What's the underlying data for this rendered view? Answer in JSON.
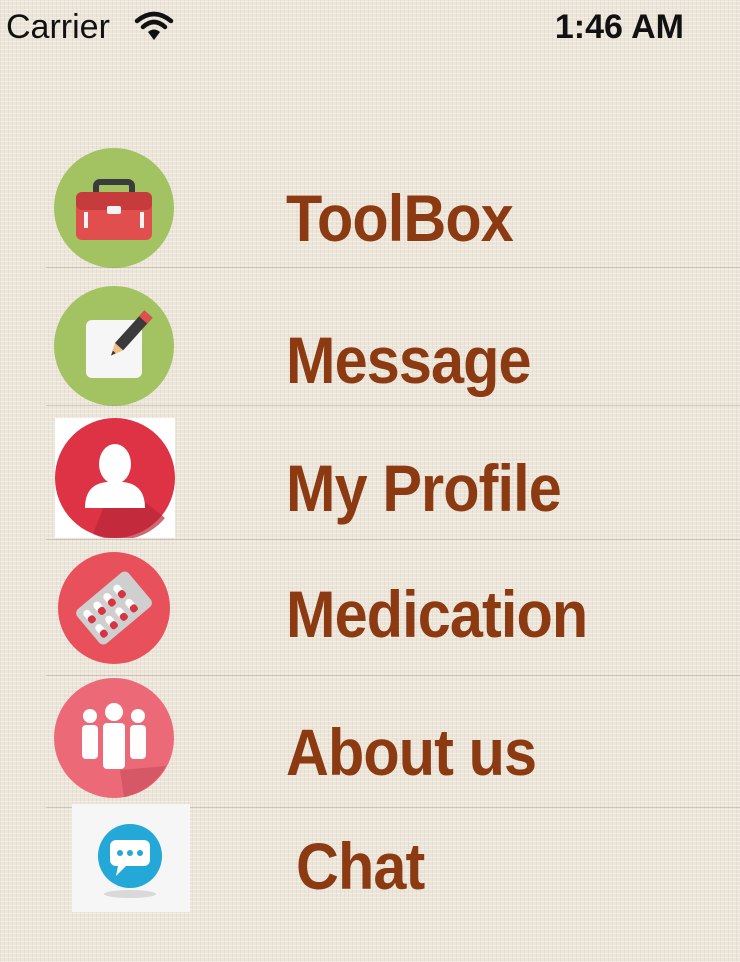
{
  "status_bar": {
    "carrier": "Carrier",
    "time": "1:46 AM",
    "wifi_icon": "wifi-icon"
  },
  "menu": {
    "items": [
      {
        "label": "ToolBox",
        "icon": "toolbox-icon",
        "color": "#a3c262"
      },
      {
        "label": "Message",
        "icon": "compose-message-icon",
        "color": "#a3c262"
      },
      {
        "label": "My Profile",
        "icon": "user-profile-icon",
        "color": "#de3245"
      },
      {
        "label": "Medication",
        "icon": "pill-blister-icon",
        "color": "#e8505b"
      },
      {
        "label": "About us",
        "icon": "group-people-icon",
        "color": "#ec6a78"
      },
      {
        "label": "Chat",
        "icon": "chat-bubble-icon",
        "color": "#23a8d8"
      }
    ]
  },
  "theme": {
    "label_color": "#8b3a12",
    "background": "#ece5d9"
  }
}
